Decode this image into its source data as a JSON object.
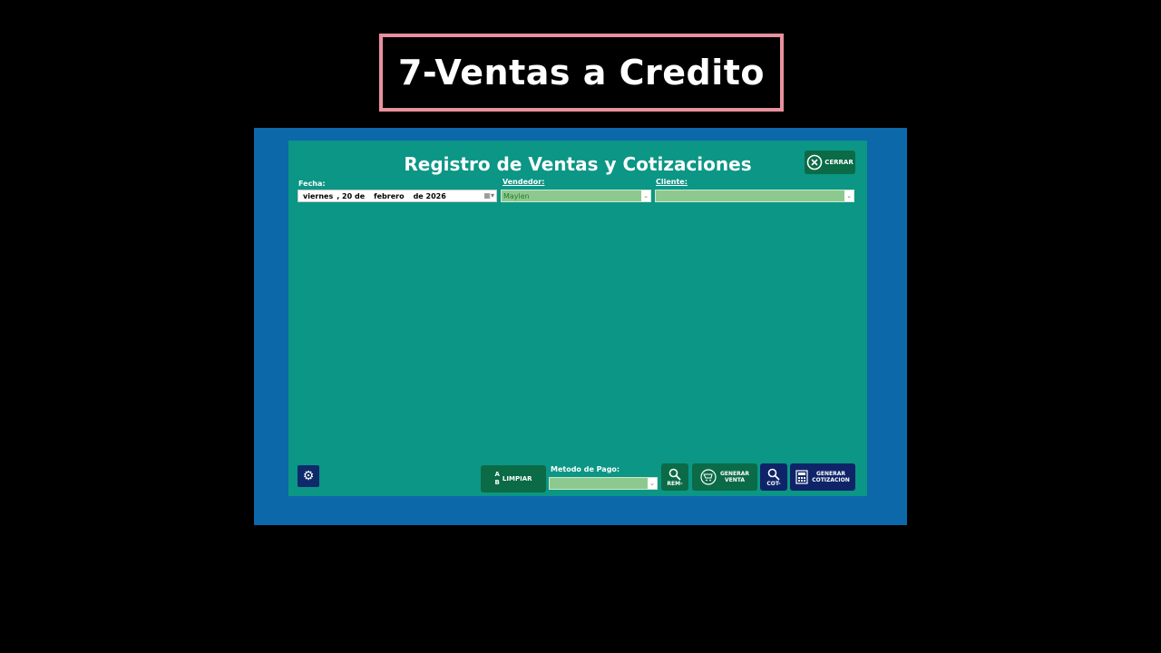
{
  "banner": {
    "title": "7-Ventas a Credito"
  },
  "form": {
    "title": "Registro de Ventas y Cotizaciones",
    "close_label": "CERRAR",
    "fecha": {
      "label": "Fecha:",
      "day_name": "viernes",
      "day": ", 20 de",
      "month": "febrero",
      "year": "de 2026"
    },
    "vendedor": {
      "label": "Vendedor:",
      "value": "Maylen"
    },
    "cliente": {
      "label": "Cliente:",
      "value": ""
    },
    "metodo_pago": {
      "label": "Metodo de Pago:",
      "value": ""
    },
    "buttons": {
      "limpiar": "LIMPIAR",
      "limpiar_a": "A",
      "limpiar_b": "B",
      "rem": "REM-",
      "generar_venta_1": "GENERAR",
      "generar_venta_2": "VENTA",
      "cot": "COT-",
      "generar_cotizacion_1": "GENERAR",
      "generar_cotizacion_2": "COTIZACION"
    }
  },
  "colors": {
    "form_bg": "#0b9685",
    "frame_bg": "#0c68a9",
    "banner_border": "#e8919e",
    "button_green": "#0b6b47",
    "button_navy": "#0f2468",
    "combo_bg": "#8dc98f"
  },
  "icons": [
    "close-circle-icon",
    "calendar-icon",
    "chevron-down-icon",
    "gear-icon",
    "magnifier-icon",
    "cart-icon",
    "calculator-icon",
    "eraser-icon"
  ]
}
